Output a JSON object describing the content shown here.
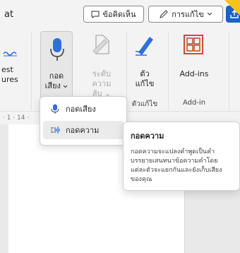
{
  "topbar": {
    "left_text": "at",
    "comments_label": "ข้อคิดเห็น",
    "editing_label": "การแก้ไข"
  },
  "ribbon": {
    "left_partial": {
      "line1": "est",
      "line2": "ures"
    },
    "dictate": {
      "line1": "กอด",
      "line2": "เสียง"
    },
    "sensitivity": {
      "line1": "ระดับความ",
      "line2": "ลับ"
    },
    "editor": {
      "line1": "ตัว",
      "line2": "แก้ไข"
    },
    "addins": {
      "label": "Add-ins"
    },
    "group_editor": "ตัวแก้ไข",
    "group_addin": "Add-in",
    "group_partial": "ย"
  },
  "ruler": {
    "text": "· 1 · 14 ·"
  },
  "menu": {
    "items": [
      {
        "label": "กอดเสียง",
        "icon": "microphone-icon"
      },
      {
        "label": "กอดความ",
        "icon": "transcribe-icon"
      }
    ]
  },
  "tooltip": {
    "title": "กอดความ",
    "body": "กอดความจะแปลงคำพูดเป็นคำบรรยายเสนทนาข้อความคำโดยแต่ละตัวจะแยกกันและยังเก็บเสียงของคุณ"
  },
  "colors": {
    "accent_blue": "#1a62c9",
    "mic_blue": "#2f6fde",
    "addins_red": "#d04a3a",
    "corner_yellow": "#f7c21b"
  }
}
